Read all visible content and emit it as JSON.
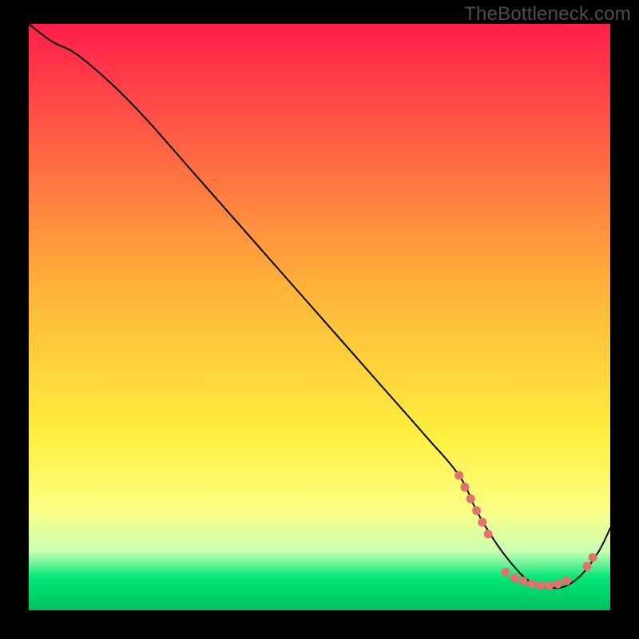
{
  "watermark": "TheBottleneck.com",
  "chart_data": {
    "type": "line",
    "title": "",
    "xlabel": "",
    "ylabel": "",
    "xlim": [
      0,
      100
    ],
    "ylim": [
      0,
      100
    ],
    "background_gradient": {
      "stops": [
        {
          "offset": 0.0,
          "color": "#ff1e4c"
        },
        {
          "offset": 0.45,
          "color": "#ffb23a"
        },
        {
          "offset": 0.7,
          "color": "#ffef3f"
        },
        {
          "offset": 0.83,
          "color": "#fbff86"
        },
        {
          "offset": 0.9,
          "color": "#c8ffb4"
        },
        {
          "offset": 0.945,
          "color": "#00e676"
        },
        {
          "offset": 1.0,
          "color": "#00c060"
        }
      ]
    },
    "series": [
      {
        "name": "bottleneck-curve",
        "color": "#000000",
        "stroke_width": 2,
        "x": [
          0,
          4,
          8,
          14,
          20,
          28,
          36,
          44,
          52,
          60,
          68,
          74,
          77,
          80,
          83,
          86,
          89,
          92,
          95,
          98,
          100
        ],
        "y": [
          100,
          97,
          95,
          90,
          84,
          75,
          66,
          57,
          48,
          39,
          30,
          23,
          17,
          12,
          8,
          5,
          4,
          4,
          6,
          10,
          14
        ]
      }
    ],
    "markers": {
      "name": "dense-points",
      "color": "#e2726b",
      "radius": 5.5,
      "points": [
        {
          "x": 74.0,
          "y": 23.0
        },
        {
          "x": 75.0,
          "y": 21.0
        },
        {
          "x": 76.0,
          "y": 19.0
        },
        {
          "x": 77.0,
          "y": 17.0
        },
        {
          "x": 78.0,
          "y": 15.0
        },
        {
          "x": 79.0,
          "y": 13.0
        },
        {
          "x": 82.0,
          "y": 6.5
        },
        {
          "x": 83.5,
          "y": 5.5
        },
        {
          "x": 85.0,
          "y": 5.0
        },
        {
          "x": 86.5,
          "y": 4.5
        },
        {
          "x": 88.0,
          "y": 4.2
        },
        {
          "x": 89.5,
          "y": 4.2
        },
        {
          "x": 91.0,
          "y": 4.5
        },
        {
          "x": 92.5,
          "y": 5.0
        },
        {
          "x": 96.0,
          "y": 7.5
        },
        {
          "x": 97.0,
          "y": 9.0
        }
      ]
    }
  }
}
